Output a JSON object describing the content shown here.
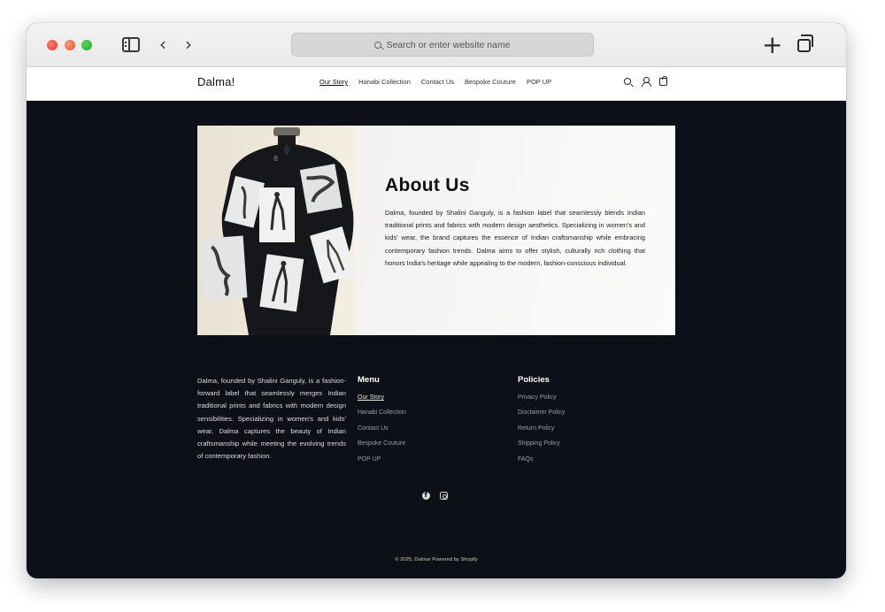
{
  "browser": {
    "address_placeholder": "Search or enter website name"
  },
  "header": {
    "brand": "Dalma!",
    "nav": [
      "Our Story",
      "Hanabi Collection",
      "Contact Us",
      "Bespoke Couture",
      "POP UP"
    ],
    "active_nav": "Our Story"
  },
  "about": {
    "title": "About Us",
    "body": "Dalma, founded by Shalini Ganguly, is a fashion label that seamlessly blends Indian traditional prints and fabrics with modern design aesthetics. Specializing in women's and kids' wear, the brand captures the essence of Indian craftsmanship while embracing contemporary fashion trends. Dalma aims to offer stylish, culturally rich clothing that honors India's heritage while appealing to the modern, fashion-conscious individual."
  },
  "footer": {
    "about_text": "Dalma, founded by Shalini Ganguly, is a fashion-forward label that seamlessly merges Indian traditional prints and fabrics with modern design sensibilities. Specializing in women's and kids' wear, Dalma captures the beauty of Indian craftsmanship while meeting the evolving trends of contemporary fashion.",
    "menu_heading": "Menu",
    "menu": [
      "Our Story",
      "Hanabi Collection",
      "Contact Us",
      "Bespoke Couture",
      "POP UP"
    ],
    "policies_heading": "Policies",
    "policies": [
      "Privacy Policy",
      "Disclaimer Policy",
      "Return Policy",
      "Shipping Policy",
      "FAQs"
    ],
    "copyright": "© 2025, Dalma! Powered by Shopify"
  },
  "colors": {
    "page_bg": "#0d1018",
    "header_bg": "#ffffff"
  },
  "icons": [
    "sidebar-icon",
    "back-arrow-icon",
    "forward-arrow-icon",
    "search-icon",
    "new-tab-icon",
    "tabs-icon",
    "account-icon",
    "cart-icon",
    "facebook-icon",
    "instagram-icon"
  ]
}
